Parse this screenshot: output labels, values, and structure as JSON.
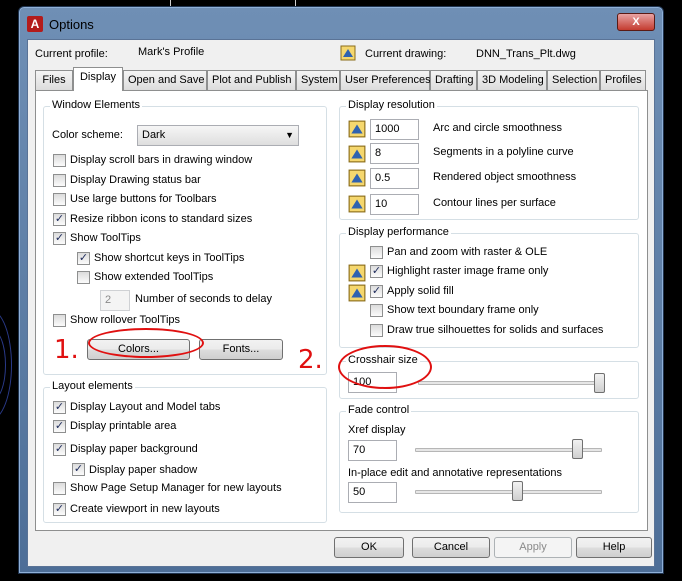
{
  "window": {
    "title": "Options",
    "close_label": "X"
  },
  "header": {
    "current_profile_label": "Current profile:",
    "current_profile_value": "Mark's Profile",
    "current_drawing_label": "Current drawing:",
    "current_drawing_value": "DNN_Trans_Plt.dwg"
  },
  "tabs": [
    {
      "label": "Files"
    },
    {
      "label": "Display"
    },
    {
      "label": "Open and Save"
    },
    {
      "label": "Plot and Publish"
    },
    {
      "label": "System"
    },
    {
      "label": "User Preferences"
    },
    {
      "label": "Drafting"
    },
    {
      "label": "3D Modeling"
    },
    {
      "label": "Selection"
    },
    {
      "label": "Profiles"
    }
  ],
  "window_elements": {
    "title": "Window Elements",
    "color_scheme_label": "Color scheme:",
    "color_scheme_value": "Dark",
    "checkboxes": [
      {
        "label": "Display scroll bars in drawing window",
        "checked": false
      },
      {
        "label": "Display Drawing status bar",
        "checked": false
      },
      {
        "label": "Use large buttons for Toolbars",
        "checked": false
      },
      {
        "label": "Resize ribbon icons to standard sizes",
        "checked": true
      },
      {
        "label": "Show ToolTips",
        "checked": true
      },
      {
        "label": "Show shortcut keys in ToolTips",
        "checked": true
      },
      {
        "label": "Show extended ToolTips",
        "checked": false
      }
    ],
    "delay_value": "2",
    "delay_label": "Number of seconds to delay",
    "rollover_label": "Show rollover ToolTips",
    "rollover_checked": false,
    "colors_button": "Colors...",
    "fonts_button": "Fonts..."
  },
  "layout_elements": {
    "title": "Layout elements",
    "checkboxes": [
      {
        "label": "Display Layout and Model tabs",
        "checked": true
      },
      {
        "label": "Display printable area",
        "checked": true
      },
      {
        "label": "Display paper background",
        "checked": true
      },
      {
        "label": "Display paper shadow",
        "checked": true
      },
      {
        "label": "Show Page Setup Manager for new layouts",
        "checked": false
      },
      {
        "label": "Create viewport in new layouts",
        "checked": true
      }
    ]
  },
  "display_resolution": {
    "title": "Display resolution",
    "rows": [
      {
        "value": "1000",
        "label": "Arc and circle smoothness"
      },
      {
        "value": "8",
        "label": "Segments in a polyline curve"
      },
      {
        "value": "0.5",
        "label": "Rendered object smoothness"
      },
      {
        "value": "10",
        "label": "Contour lines per surface"
      }
    ]
  },
  "display_performance": {
    "title": "Display performance",
    "checkboxes": [
      {
        "label": "Pan and zoom with raster & OLE",
        "checked": false
      },
      {
        "label": "Highlight raster image frame only",
        "checked": true
      },
      {
        "label": "Apply solid fill",
        "checked": true
      },
      {
        "label": "Show text boundary frame only",
        "checked": false
      },
      {
        "label": "Draw true silhouettes for solids and surfaces",
        "checked": false
      }
    ]
  },
  "crosshair": {
    "title": "Crosshair size",
    "value": "100",
    "level": 100
  },
  "fade_control": {
    "title": "Fade control",
    "xref_label": "Xref display",
    "xref_value": "70",
    "xref_level": 70,
    "inplace_label": "In-place edit and annotative representations",
    "inplace_value": "50",
    "inplace_level": 50
  },
  "footer": {
    "ok": "OK",
    "cancel": "Cancel",
    "apply": "Apply",
    "help": "Help"
  },
  "annotations": {
    "one": "1.",
    "two": "2."
  },
  "colors": {
    "annotation_red": "#e01010",
    "title_bar_blue": "#5b7ca6",
    "check_blue": "#1d2a5a"
  }
}
